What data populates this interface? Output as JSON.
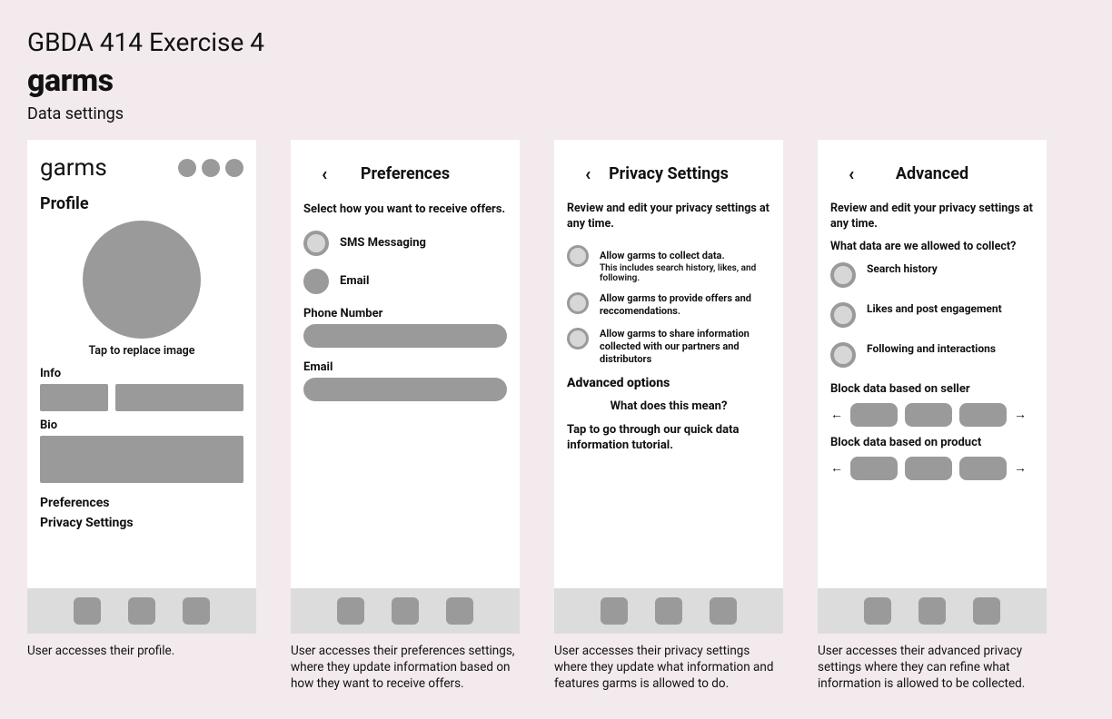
{
  "header": {
    "supertitle": "GBDA 414 Exercise 4",
    "title": "garms",
    "subtitle": "Data settings"
  },
  "screens": {
    "profile": {
      "brand": "garms",
      "title": "Profile",
      "avatar_caption": "Tap to replace image",
      "info_label": "Info",
      "bio_label": "Bio",
      "links": [
        "Preferences",
        "Privacy Settings"
      ],
      "caption": "User accesses their profile."
    },
    "preferences": {
      "nav_title": "Preferences",
      "help": "Select how you want to receive offers.",
      "options": [
        "SMS Messaging",
        "Email"
      ],
      "phone_label": "Phone Number",
      "email_label": "Email",
      "caption": "User accesses their preferences settings, where they update information based on how they want to receive offers."
    },
    "privacy": {
      "nav_title": "Privacy Settings",
      "help": "Review and edit your privacy settings at any time.",
      "options": [
        {
          "main": "Allow garms to collect data.",
          "sub": "This includes search history, likes, and following."
        },
        {
          "main": "Allow garms to provide offers and reccomendations.",
          "sub": ""
        },
        {
          "main": "Allow garms to share information collected with our partners and distributors",
          "sub": ""
        }
      ],
      "advanced_label": "Advanced options",
      "mean_link": "What does this mean?",
      "tutorial": "Tap to go through our quick data information tutorial.",
      "caption": "User accesses their privacy settings where they update what information and features garms is allowed to do."
    },
    "advanced": {
      "nav_title": "Advanced",
      "help": "Review and edit your privacy settings at any time.",
      "subq": "What data are we allowed to collect?",
      "options": [
        "Search history",
        "Likes and post engagement",
        "Following and interactions"
      ],
      "block_seller": "Block data based on seller",
      "block_product": "Block data based on product",
      "caption": "User accesses their advanced privacy settings where they can refine what information is allowed to be collected."
    }
  }
}
